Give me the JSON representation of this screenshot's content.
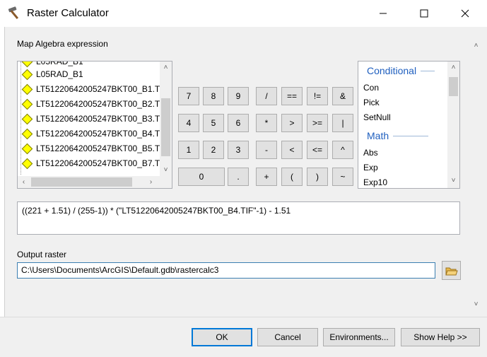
{
  "window": {
    "title": "Raster Calculator",
    "icon": "hammer-icon",
    "controls": [
      "minimize-icon",
      "maximize-icon",
      "close-icon"
    ]
  },
  "expression_label": "Map Algebra expression",
  "layers": [
    "L05RAD_B1",
    "LT51220642005247BKT00_B1.T",
    "LT51220642005247BKT00_B2.T",
    "LT51220642005247BKT00_B3.T",
    "LT51220642005247BKT00_B4.T",
    "LT51220642005247BKT00_B5.T",
    "LT51220642005247BKT00_B7.T"
  ],
  "layer_partial_top": "L05RAD_B1",
  "calculator": {
    "row1": [
      "7",
      "8",
      "9",
      "/",
      "==",
      "!=",
      "&"
    ],
    "row2": [
      "4",
      "5",
      "6",
      "*",
      ">",
      ">=",
      "|"
    ],
    "row3": [
      "1",
      "2",
      "3",
      "-",
      "<",
      "<=",
      "^"
    ],
    "row4": [
      "0",
      ".",
      "+",
      "(",
      ")",
      "~"
    ]
  },
  "tools": {
    "conditional_header": "Conditional",
    "conditional_items": [
      "Con",
      "Pick",
      "SetNull"
    ],
    "math_header": "Math",
    "math_items": [
      "Abs",
      "Exp",
      "Exp10"
    ]
  },
  "expression": "((221 + 1.51) / (255-1)) * (\"LT51220642005247BKT00_B4.TIF\"-1) - 1.51",
  "output_label": "Output raster",
  "output_value": "C:\\Users\\Documents\\ArcGIS\\Default.gdb\\rastercalc3",
  "buttons": {
    "ok": "OK",
    "cancel": "Cancel",
    "environments": "Environments...",
    "show_help": "Show Help >>"
  },
  "colors": {
    "accent": "#0078d7",
    "header_blue": "#1f5fbf",
    "layer_symbol": "#ffff00"
  }
}
